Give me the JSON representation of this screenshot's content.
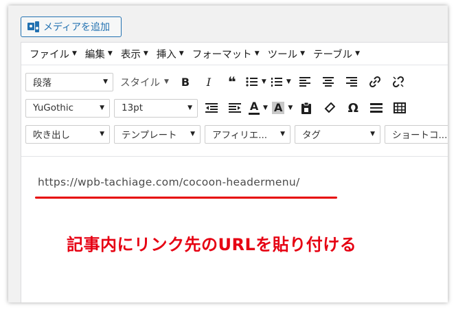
{
  "media_button": {
    "label": "メディアを追加",
    "icon": "add-media-icon"
  },
  "menubar": [
    {
      "label": "ファイル"
    },
    {
      "label": "編集"
    },
    {
      "label": "表示"
    },
    {
      "label": "挿入"
    },
    {
      "label": "フォーマット"
    },
    {
      "label": "ツール"
    },
    {
      "label": "テーブル"
    }
  ],
  "toolbar": {
    "format_select": "段落",
    "style_label": "スタイル",
    "bold": "B",
    "italic": "I",
    "blockquote": "❝",
    "font_family": "YuGothic",
    "font_size": "13pt",
    "text_color_glyph": "A",
    "bg_color_glyph": "A",
    "special_char": "Ω",
    "balloon": "吹き出し",
    "template": "テンプレート",
    "affiliate": "アフィリエ...",
    "tag": "タグ",
    "shortcode": "ショートコ..."
  },
  "content": {
    "url": "https://wpb-tachiage.com/cocoon-headermenu/",
    "annotation": "記事内にリンク先のURLを貼り付ける"
  },
  "colors": {
    "accent": "#2271b1",
    "annotation": "#e60012",
    "underline": "#e60000"
  }
}
